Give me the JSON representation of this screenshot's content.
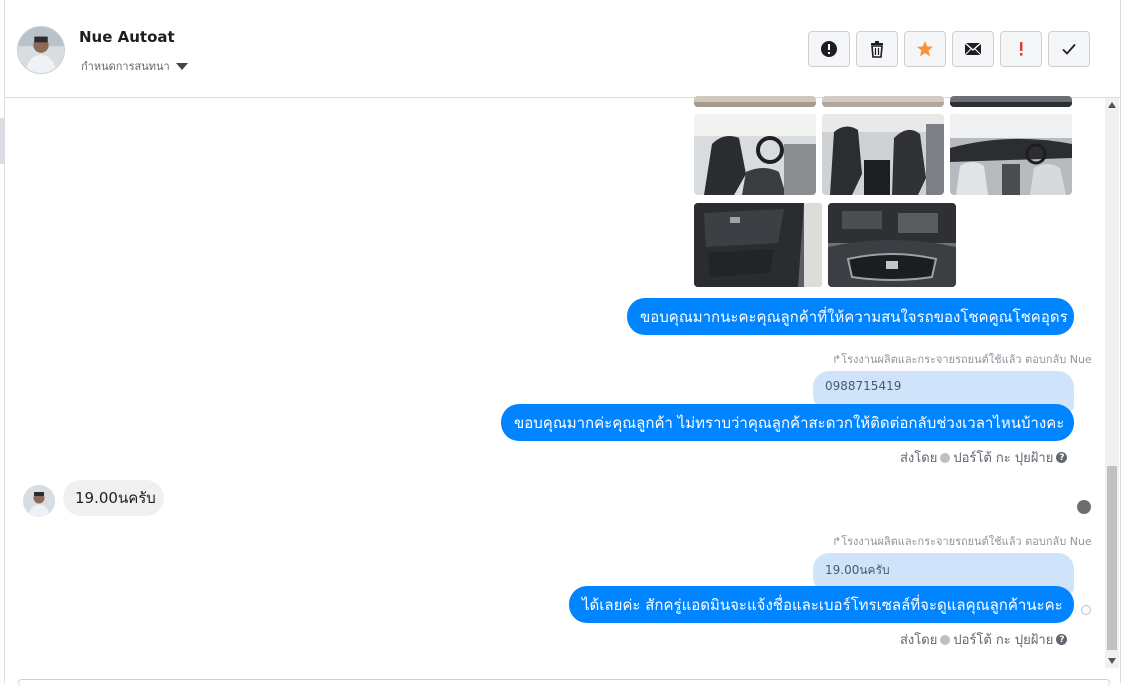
{
  "header": {
    "contact_name": "Nue Autoat",
    "assign_label": "กำหนดการสนทนา",
    "tools": [
      {
        "name": "mark-spam",
        "icon": "alert-circle-icon"
      },
      {
        "name": "delete",
        "icon": "trash-icon"
      },
      {
        "name": "star",
        "icon": "star-icon",
        "color": "#f7923b"
      },
      {
        "name": "mark-unread",
        "icon": "envelope-icon"
      },
      {
        "name": "follow-up",
        "icon": "exclamation-icon",
        "color": "#e53935"
      },
      {
        "name": "mark-done",
        "icon": "check-icon"
      }
    ]
  },
  "messages": {
    "page_msg_1": "ขอบคุณมากนะคะคุณลูกค้าที่ให้ความสนใจรถของโชคคูณโชคอุดร",
    "reply_note_1": "โรงงานผลิตและกระจายรถยนต์ใช้แล้ว ตอบกลับ Nue",
    "quote_1": "0988715419",
    "page_msg_2": "ขอบคุณมากค่ะคุณลูกค้า ไม่ทราบว่าคุณลูกค้าสะดวกให้ติดต่อกลับช่วงเวลาไหนบ้างคะ",
    "sent_by_1": "ส่งโดย",
    "sender_1": "ปอร์โต้ กะ ปุยฝ้าย",
    "customer_msg": "19.00นครับ",
    "reply_note_2": "โรงงานผลิตและกระจายรถยนต์ใช้แล้ว ตอบกลับ Nue",
    "quote_2": "19.00นครับ",
    "page_msg_3": "ได้เลยค่ะ สักครู่แอดมินจะแจ้งชื่อและเบอร์โทรเซลล์ที่จะดูแลคุณลูกค้านะคะ",
    "sent_by_2": "ส่งโดย",
    "sender_2": "ปอร์โต้ กะ ปุยฝ้าย",
    "help_glyph": "?"
  },
  "colors": {
    "outgoing_bubble": "#0084ff",
    "quote_bubble": "#cfe4fb",
    "incoming_bubble": "#f1f0f0"
  }
}
